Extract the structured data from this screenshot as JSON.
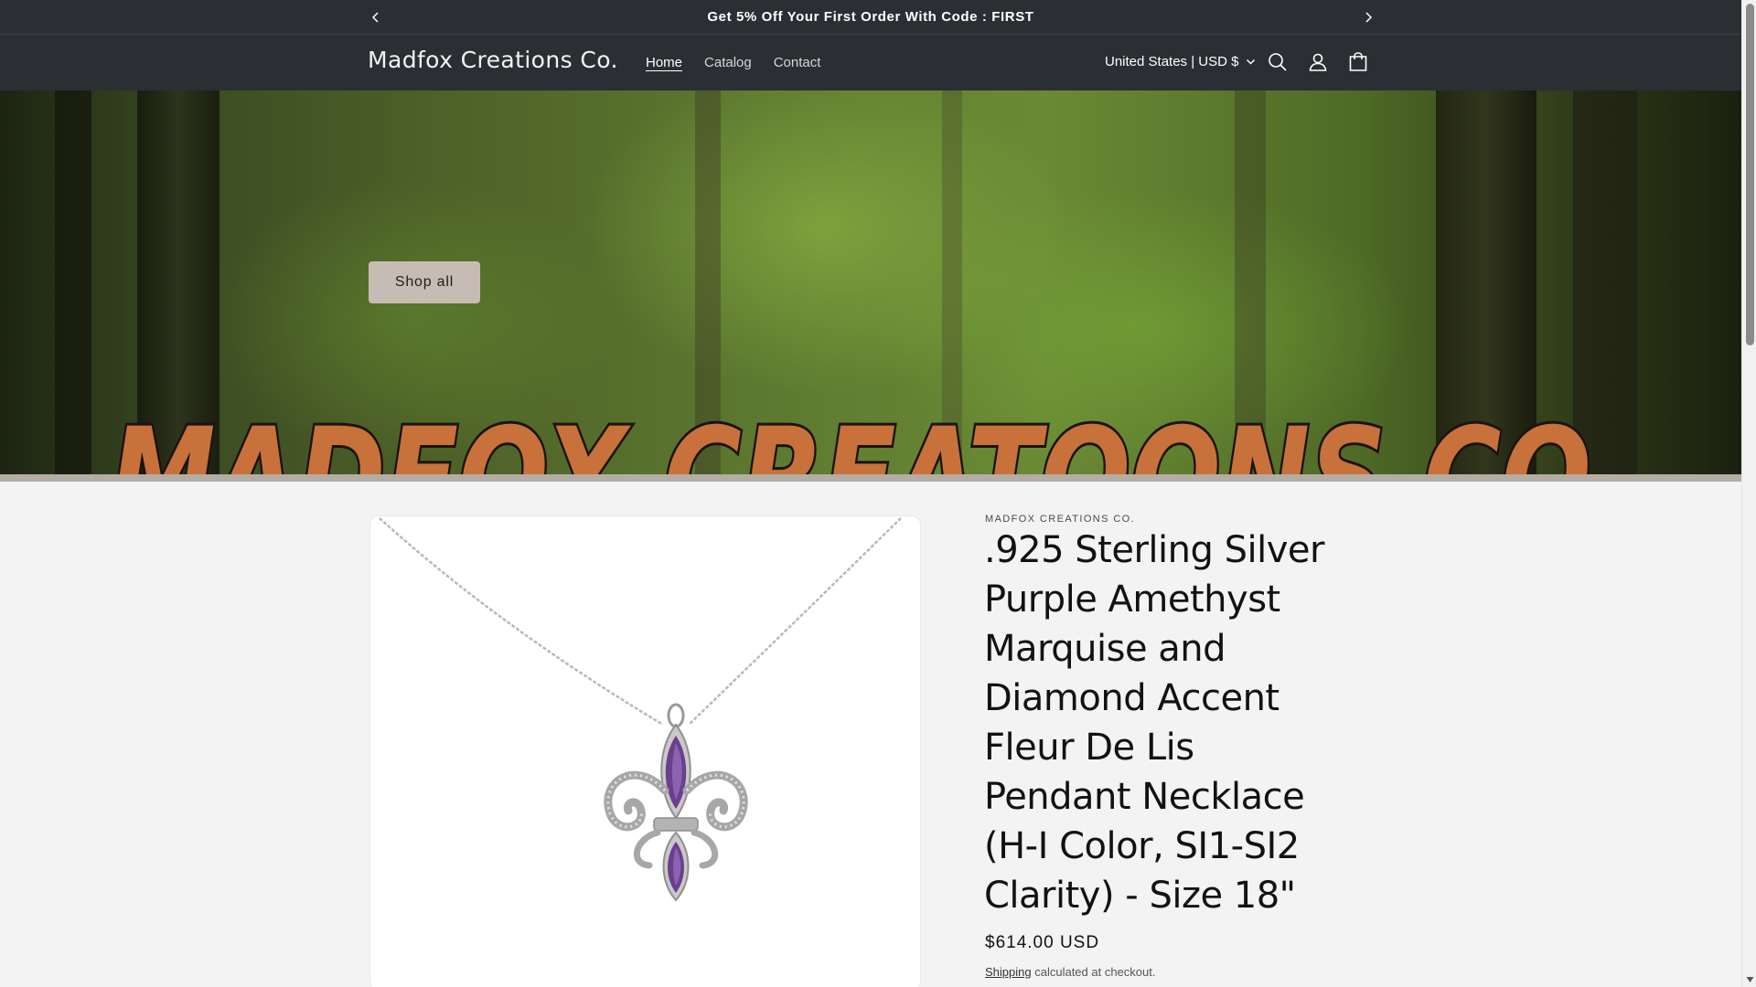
{
  "announcement": {
    "message": "Get 5% Off Your First Order With Code : FIRST",
    "prev_icon": "chevron-left-icon",
    "next_icon": "chevron-right-icon"
  },
  "header": {
    "logo": "Madfox Creations Co.",
    "nav": [
      {
        "label": "Home",
        "active": true
      },
      {
        "label": "Catalog",
        "active": false
      },
      {
        "label": "Contact",
        "active": false
      }
    ],
    "country_selector": "United States | USD $",
    "icons": [
      "search-icon",
      "account-icon",
      "cart-icon"
    ]
  },
  "hero": {
    "button_label": "Shop all",
    "background_logo": "MADFOX CREATOONS CO"
  },
  "product": {
    "vendor": "MADFOX CREATIONS CO.",
    "title": ".925 Sterling Silver Purple Amethyst Marquise and Diamond Accent Fleur De Lis Pendant Necklace (H-I Color, SI1-SI2 Clarity) - Size 18\"",
    "price": "$614.00 USD",
    "shipping_link": "Shipping",
    "shipping_suffix": " calculated at checkout."
  },
  "colors": {
    "header_bg": "#2b2f33",
    "page_bg": "#f3f3f3",
    "button_bg": "#c7bcb4",
    "hero_logo_orange": "#c8713b",
    "amethyst": "#6b3f8c"
  }
}
